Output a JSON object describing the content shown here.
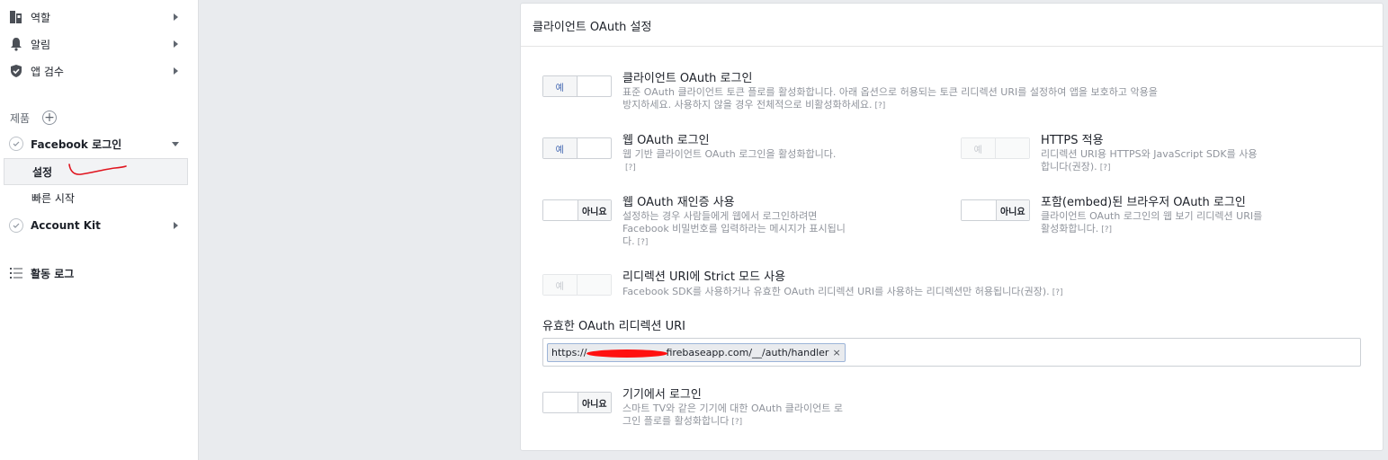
{
  "sidebar": {
    "roles": "역할",
    "alerts": "알림",
    "app_review": "앱 검수",
    "products": "제품",
    "facebook_login": "Facebook 로그인",
    "settings": "설정",
    "quick_start": "빠른 시작",
    "account_kit": "Account Kit",
    "activity_log": "활동 로그"
  },
  "panel": {
    "title": "클라이언트 OAuth 설정"
  },
  "toggle_yes": "예",
  "toggle_no": "아니요",
  "help": "[?]",
  "settings": {
    "client_oauth": {
      "title": "클라이언트 OAuth 로그인",
      "desc": "표준 OAuth 클라이언트 토큰 플로를 활성화합니다. 아래 옵션으로 허용되는 토큰 리디렉션 URI를 설정하여 앱을 보호하고 악용을 방지하세요. 사용하지 않을 경우 전체적으로 비활성화하세요.",
      "state": "예"
    },
    "web_oauth": {
      "title": "웹 OAuth 로그인",
      "desc": "웹 기반 클라이언트 OAuth 로그인을 활성화합니다.",
      "state": "예"
    },
    "https": {
      "title": "HTTPS 적용",
      "desc": "리디렉션 URI용 HTTPS와 JavaScript SDK를 사용합니다(권장).",
      "state": "예"
    },
    "web_reauth": {
      "title": "웹 OAuth 재인증 사용",
      "desc": "설정하는 경우 사람들에게 웹에서 로그인하려면 Facebook 비밀번호를 입력하라는 메시지가 표시됩니다.",
      "state": "아니요"
    },
    "embedded": {
      "title": "포함(embed)된 브라우저 OAuth 로그인",
      "desc": "클라이언트 OAuth 로그인의 웹 보기 리디렉션 URI를 활성화합니다.",
      "state": "아니요"
    },
    "strict": {
      "title": "리디렉션 URI에 Strict 모드 사용",
      "desc": "Facebook SDK를 사용하거나 유효한 OAuth 리디렉션 URI를 사용하는 리디렉션만 허용됩니다(권장).",
      "state": "예"
    },
    "device": {
      "title": "기기에서 로그인",
      "desc": "스마트 TV와 같은 기기에 대한 OAuth 클라이언트 로그인 플로를 활성화합니다",
      "state": "아니요"
    }
  },
  "redirect": {
    "label": "유효한 OAuth 리디렉션 URI",
    "token_prefix": "https://",
    "token_suffix": "firebaseapp.com/__/auth/handler",
    "remove": "×"
  },
  "colors": {
    "accent": "#4267b2",
    "annotation": "#e0141e"
  }
}
